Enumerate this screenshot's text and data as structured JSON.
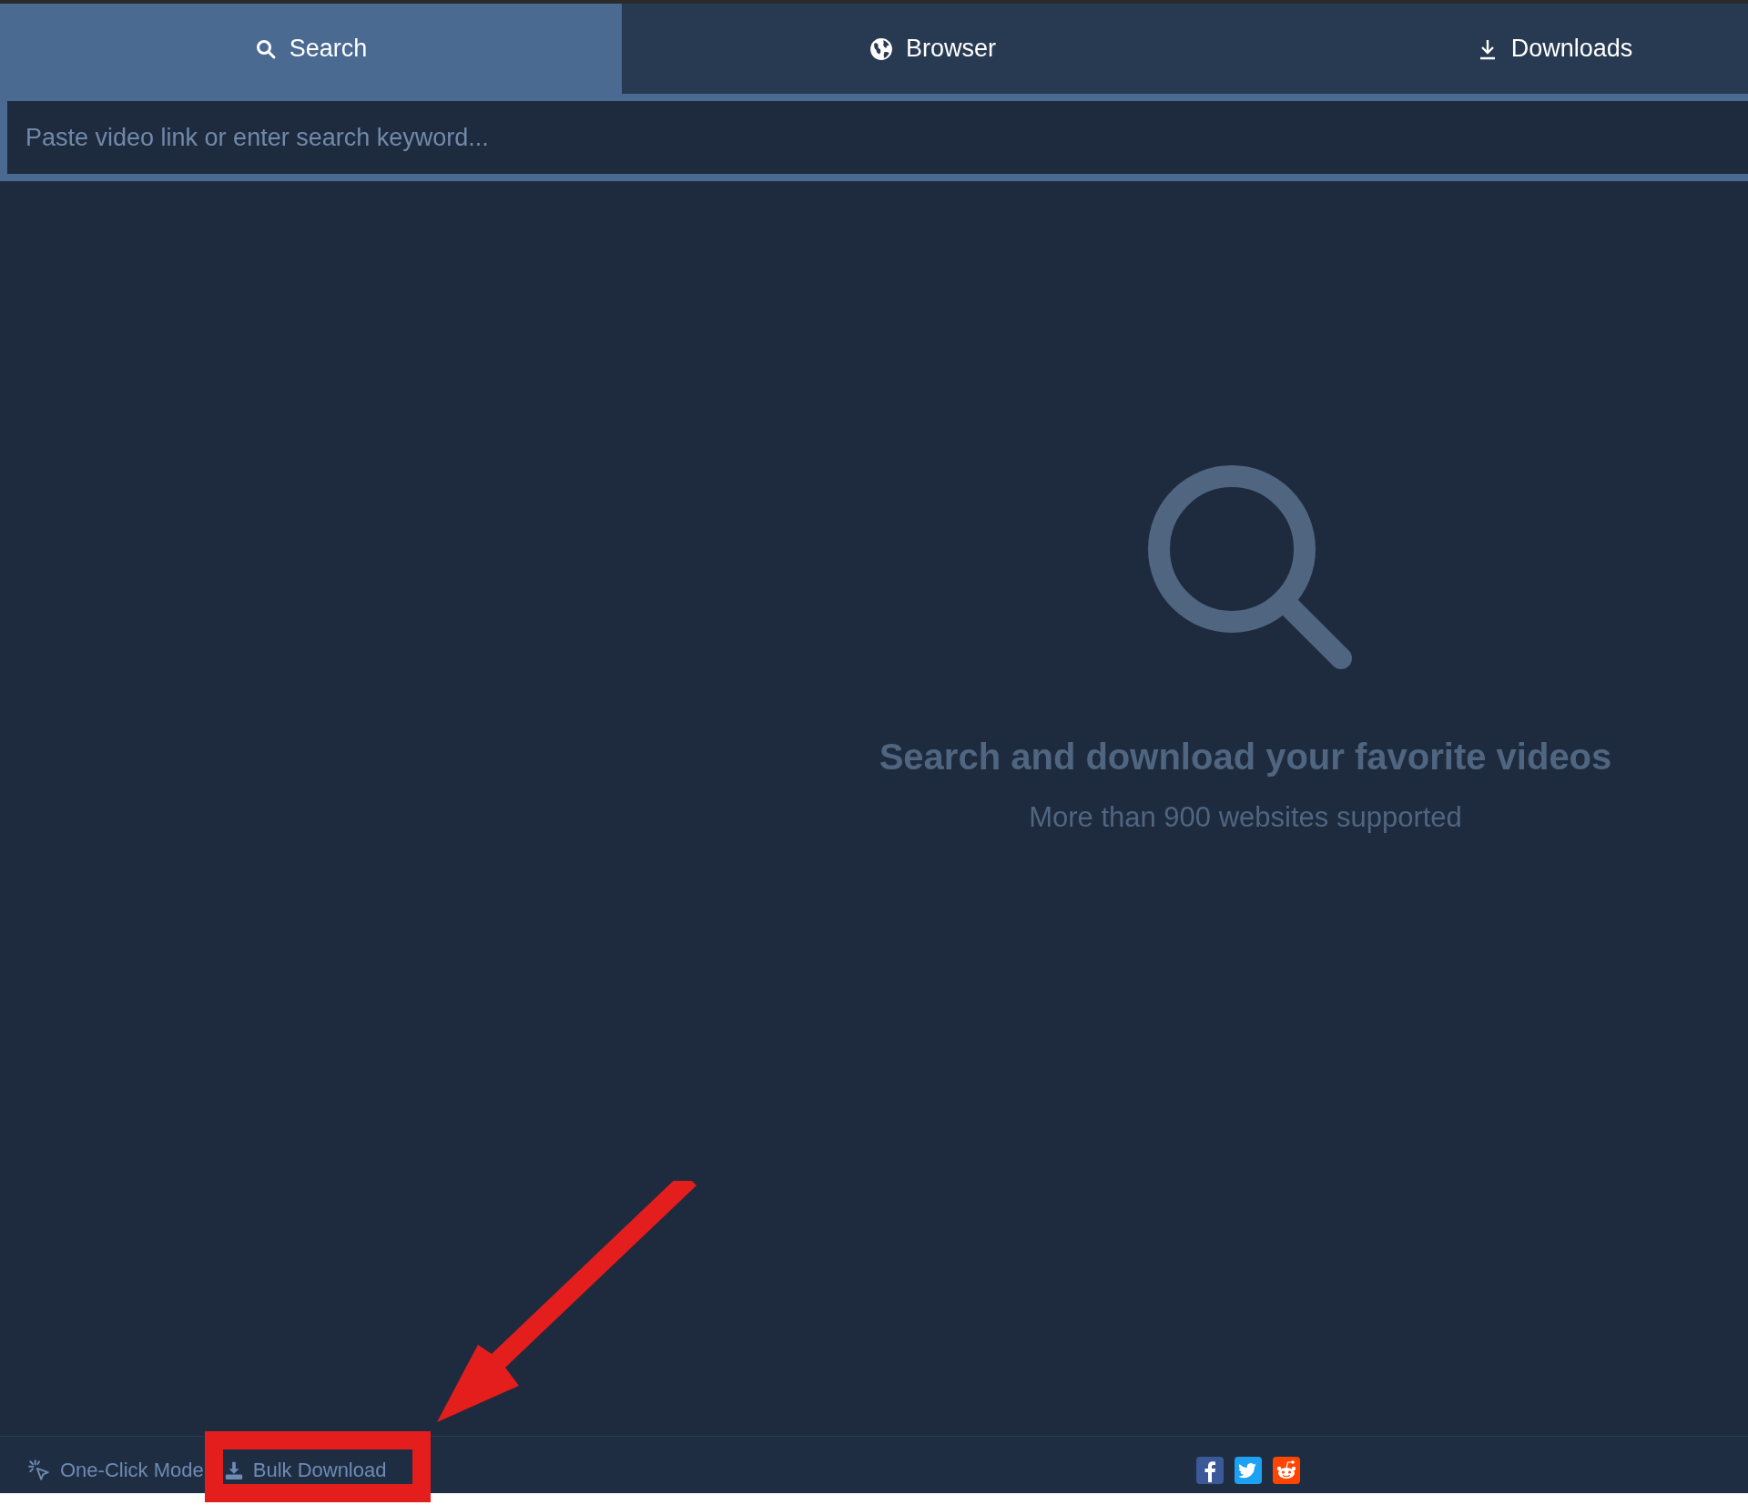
{
  "tabs": [
    {
      "label": "Search",
      "selected": true
    },
    {
      "label": "Browser",
      "selected": false
    },
    {
      "label": "Downloads",
      "selected": false
    }
  ],
  "search": {
    "placeholder": "Paste video link or enter search keyword..."
  },
  "empty_state": {
    "title": "Search and download your favorite videos",
    "subtitle": "More than 900 websites supported"
  },
  "footer": {
    "items": [
      {
        "label": "One-Click Mode"
      },
      {
        "label": "Bulk Download"
      }
    ]
  }
}
